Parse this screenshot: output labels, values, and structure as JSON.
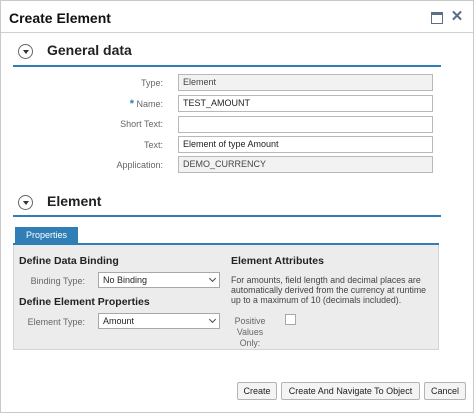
{
  "dialog": {
    "title": "Create Element",
    "maximize_icon": "maximize-icon",
    "close_icon": "close-icon"
  },
  "general_section": {
    "title": "General data",
    "toggle_icon": "collapse-toggle-icon",
    "fields": {
      "type": {
        "label": "Type:",
        "value": "Element"
      },
      "name": {
        "required_marker": "*",
        "label": "Name:",
        "value": "TEST_AMOUNT"
      },
      "short_text": {
        "label": "Short Text:",
        "value": ""
      },
      "text": {
        "label": "Text:",
        "value": "Element of type Amount"
      },
      "application": {
        "label": "Application:",
        "value": "DEMO_CURRENCY"
      }
    }
  },
  "element_section": {
    "title": "Element",
    "toggle_icon": "collapse-toggle-icon",
    "tab_label": "Properties",
    "data_binding": {
      "title": "Define Data Binding",
      "binding_type_label": "Binding Type:",
      "binding_type_value": "No Binding"
    },
    "element_properties": {
      "title": "Define Element Properties",
      "element_type_label": "Element Type:",
      "element_type_value": "Amount"
    },
    "attributes": {
      "title": "Element Attributes",
      "info_text": "For amounts, field length and decimal places are automatically derived from the currency at runtime up to a maximum of 10 (decimals included).",
      "positive_values_label": "Positive Values Only:",
      "positive_values_checked": false
    }
  },
  "footer": {
    "create_label": "Create",
    "create_navigate_label": "Create And Navigate To Object",
    "cancel_label": "Cancel"
  },
  "colors": {
    "accent": "#2f7fb6",
    "panel_bg": "#ececec",
    "readonly_bg": "#f2f2f2"
  }
}
